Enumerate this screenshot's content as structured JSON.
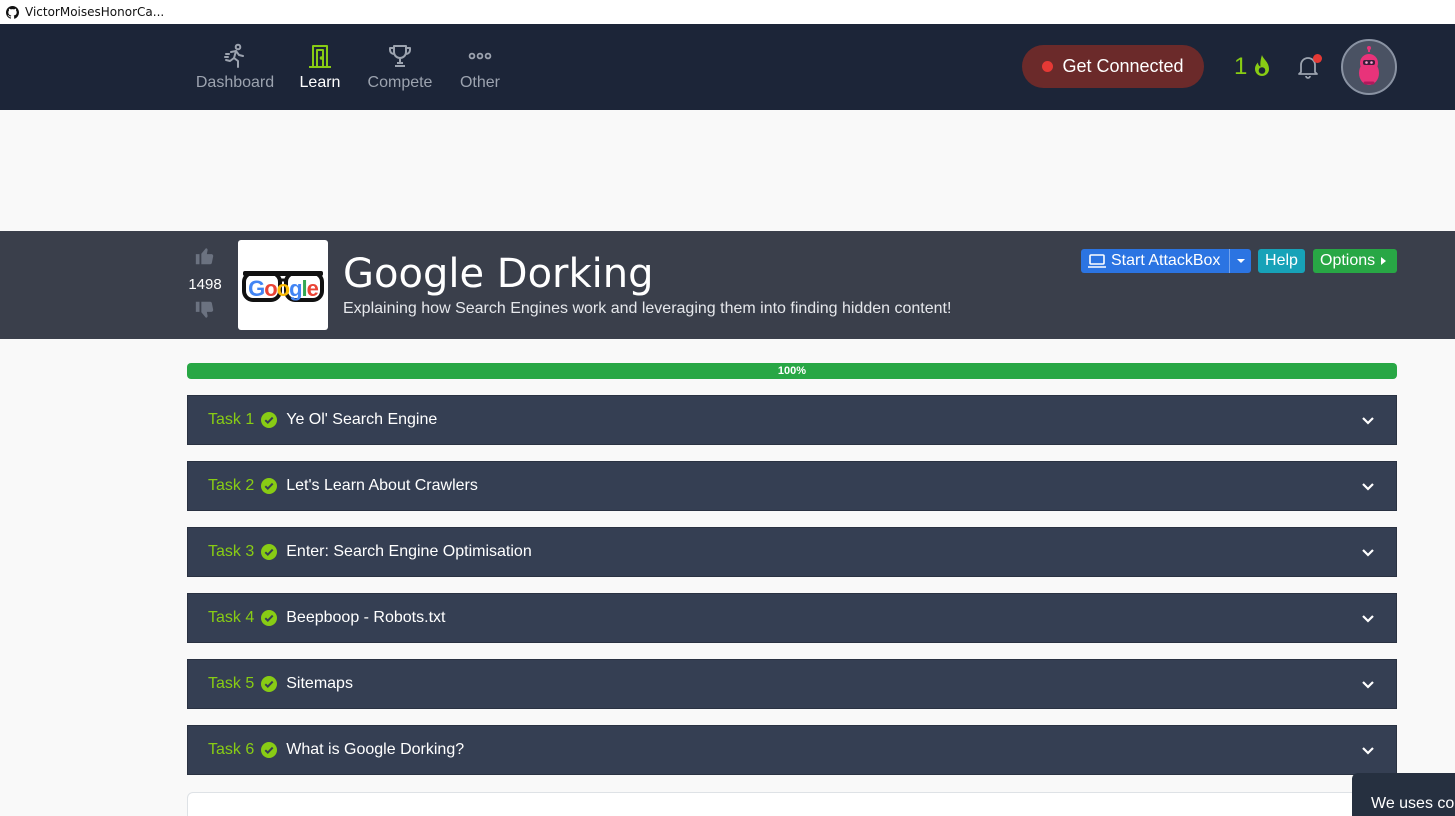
{
  "browser": {
    "tab_title": "VictorMoisesHonorCa..."
  },
  "nav": {
    "items": [
      {
        "label": "Dashboard",
        "icon": "running-person-icon",
        "active": false
      },
      {
        "label": "Learn",
        "icon": "door-icon",
        "active": true
      },
      {
        "label": "Compete",
        "icon": "trophy-icon",
        "active": false
      },
      {
        "label": "Other",
        "icon": "more-dots-icon",
        "active": false
      }
    ],
    "connect_label": "Get Connected",
    "streak_count": "1",
    "colors": {
      "bg": "#1c2538",
      "accent": "#88cc14",
      "connect_bg": "#6b2a2a",
      "alert": "#e53935"
    }
  },
  "room": {
    "votes": "1498",
    "title": "Google Dorking",
    "description": "Explaining how Search Engines work and leveraging them into finding hidden content!",
    "logo_text": "Google",
    "buttons": {
      "attackbox": "Start AttackBox",
      "help": "Help",
      "options": "Options"
    }
  },
  "progress": {
    "value": 100,
    "label": "100%"
  },
  "tasks": [
    {
      "number": "Task 1",
      "name": "Ye Ol' Search Engine",
      "completed": true
    },
    {
      "number": "Task 2",
      "name": "Let's Learn About Crawlers",
      "completed": true
    },
    {
      "number": "Task 3",
      "name": "Enter: Search Engine Optimisation",
      "completed": true
    },
    {
      "number": "Task 4",
      "name": "Beepboop - Robots.txt",
      "completed": true
    },
    {
      "number": "Task 5",
      "name": "Sitemaps",
      "completed": true
    },
    {
      "number": "Task 6",
      "name": "What is Google Dorking?",
      "completed": true
    }
  ],
  "cookie_banner": {
    "text": "We uses co"
  }
}
